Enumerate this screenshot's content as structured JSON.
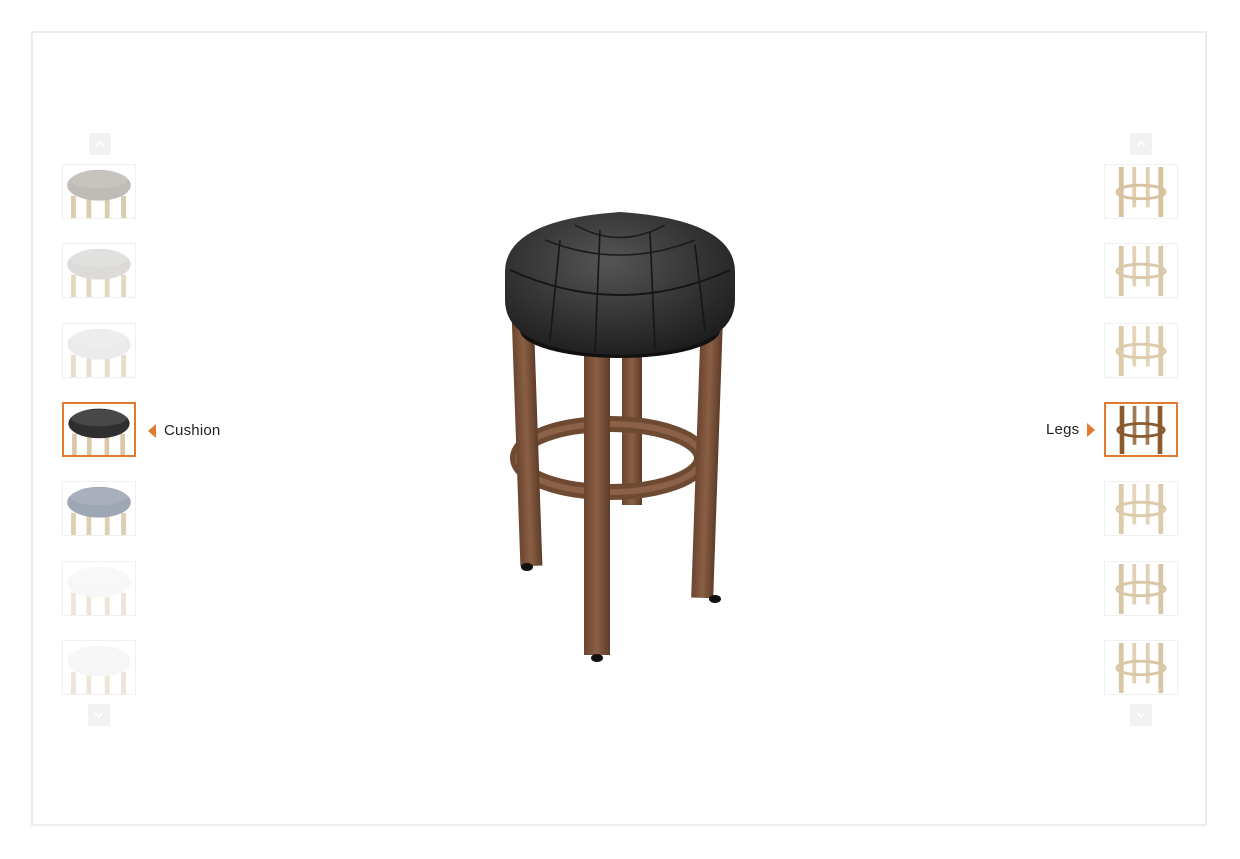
{
  "colors": {
    "accent": "#e07a2e",
    "frame": "#ededed",
    "wood": "#7a5238",
    "leather": "#2f2f2f"
  },
  "cushion": {
    "label": "Cushion",
    "selected_index": 3,
    "options": [
      {
        "name": "taupe",
        "color": "#b9b5b0",
        "opacity": 0.9
      },
      {
        "name": "light-grey",
        "color": "#cfcdcb",
        "opacity": 0.7
      },
      {
        "name": "silver",
        "color": "#dedede",
        "opacity": 0.6
      },
      {
        "name": "black",
        "color": "#2f2f2f",
        "opacity": 1.0
      },
      {
        "name": "slate-blue",
        "color": "#8f97a6",
        "opacity": 0.85
      },
      {
        "name": "white",
        "color": "#efefef",
        "opacity": 0.45
      },
      {
        "name": "ivory",
        "color": "#ededed",
        "opacity": 0.45
      }
    ]
  },
  "legs": {
    "label": "Legs",
    "selected_index": 3,
    "options": [
      {
        "name": "natural-1",
        "color": "#d8c29e"
      },
      {
        "name": "natural-2",
        "color": "#dac8a8"
      },
      {
        "name": "natural-3",
        "color": "#dccaa8"
      },
      {
        "name": "walnut",
        "color": "#8a5a2e"
      },
      {
        "name": "natural-4",
        "color": "#dccaa8"
      },
      {
        "name": "natural-5",
        "color": "#d8c6a4"
      },
      {
        "name": "natural-6",
        "color": "#d8c6a4"
      }
    ]
  }
}
